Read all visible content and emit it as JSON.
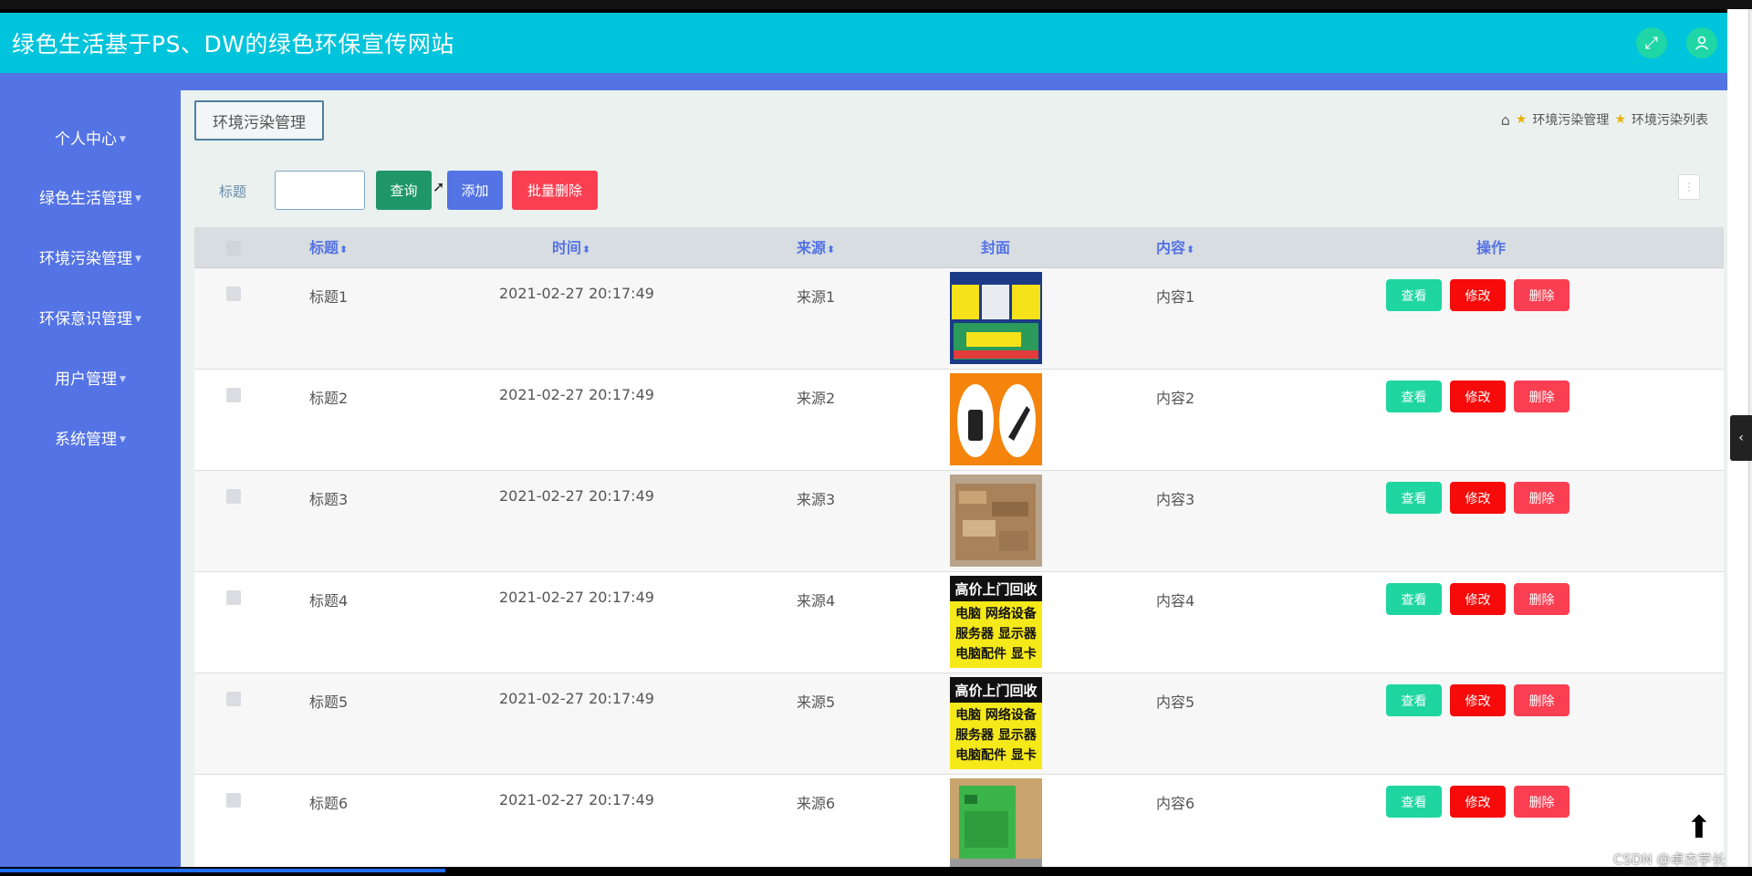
{
  "header": {
    "title": "绿色生活基于PS、DW的绿色环保宣传网站"
  },
  "sidebar": {
    "items": [
      {
        "label": "个人中心"
      },
      {
        "label": "绿色生活管理"
      },
      {
        "label": "环境污染管理"
      },
      {
        "label": "环保意识管理"
      },
      {
        "label": "用户管理"
      },
      {
        "label": "系统管理"
      }
    ]
  },
  "page": {
    "tag": "环境污染管理",
    "breadcrumb": [
      "环境污染管理",
      "环境污染列表"
    ]
  },
  "search": {
    "label": "标题",
    "value": "",
    "query_label": "查询",
    "add_label": "添加",
    "bulk_delete_label": "批量删除"
  },
  "table": {
    "headers": {
      "title": "标题",
      "time": "时间",
      "source": "来源",
      "cover": "封面",
      "content": "内容",
      "actions": "操作"
    },
    "actions": {
      "view": "查看",
      "edit": "修改",
      "delete": "删除"
    },
    "rows": [
      {
        "title": "标题1",
        "time": "2021-02-27 20:17:49",
        "source": "来源1",
        "content": "内容1",
        "cover": "poster"
      },
      {
        "title": "标题2",
        "time": "2021-02-27 20:17:49",
        "source": "来源2",
        "content": "内容2",
        "cover": "orange-icons"
      },
      {
        "title": "标题3",
        "time": "2021-02-27 20:17:49",
        "source": "来源3",
        "content": "内容3",
        "cover": "cardboard"
      },
      {
        "title": "标题4",
        "time": "2021-02-27 20:17:49",
        "source": "来源4",
        "content": "内容4",
        "cover": "recycle-ad",
        "cover_lines": [
          "高价上门回收",
          "电脑 网络设备",
          "服务器 显示器",
          "电脑配件 显卡"
        ]
      },
      {
        "title": "标题5",
        "time": "2021-02-27 20:17:49",
        "source": "来源5",
        "content": "内容5",
        "cover": "recycle-ad",
        "cover_lines": [
          "高价上门回收",
          "电脑 网络设备",
          "服务器 显示器",
          "电脑配件 显卡"
        ]
      },
      {
        "title": "标题6",
        "time": "2021-02-27 20:17:49",
        "source": "来源6",
        "content": "内容6",
        "cover": "green-bin"
      }
    ]
  },
  "watermark": "CSDN @卓杰学长",
  "colors": {
    "header": "#00c4dc",
    "sidebar": "#5473e4",
    "query": "#1e9668",
    "add": "#5473e4",
    "danger": "#fb3f52",
    "view": "#1fd6a0",
    "edit": "#f60a0a"
  }
}
